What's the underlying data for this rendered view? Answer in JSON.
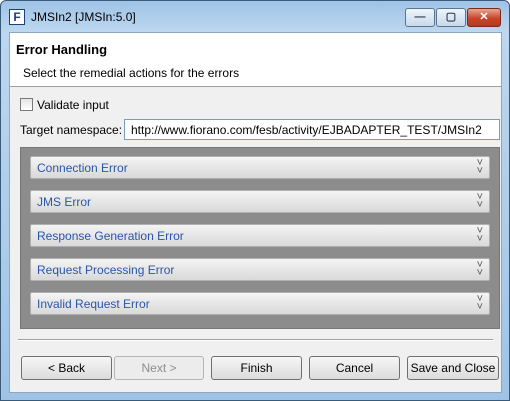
{
  "window": {
    "title": "JMSIn2 [JMSIn:5.0]",
    "app_icon_letter": "F"
  },
  "controls": {
    "minimize": "—",
    "maximize": "▢",
    "close": "✕"
  },
  "header": {
    "title": "Error Handling",
    "subtitle": "Select the remedial actions for the errors"
  },
  "validate": {
    "label": "Validate input",
    "checked": false
  },
  "namespace": {
    "label": "Target namespace:",
    "value": "http://www.fiorano.com/fesb/activity/EJBADAPTER_TEST/JMSIn2"
  },
  "errors": [
    {
      "label": "Connection Error"
    },
    {
      "label": "JMS Error"
    },
    {
      "label": "Response Generation Error"
    },
    {
      "label": "Request Processing Error"
    },
    {
      "label": "Invalid Request Error"
    }
  ],
  "buttons": {
    "back": {
      "label": "< Back"
    },
    "next": {
      "label": "Next >"
    },
    "finish": {
      "label": "Finish"
    },
    "cancel": {
      "label": "Cancel"
    },
    "save": {
      "label": "Save and Close"
    }
  }
}
